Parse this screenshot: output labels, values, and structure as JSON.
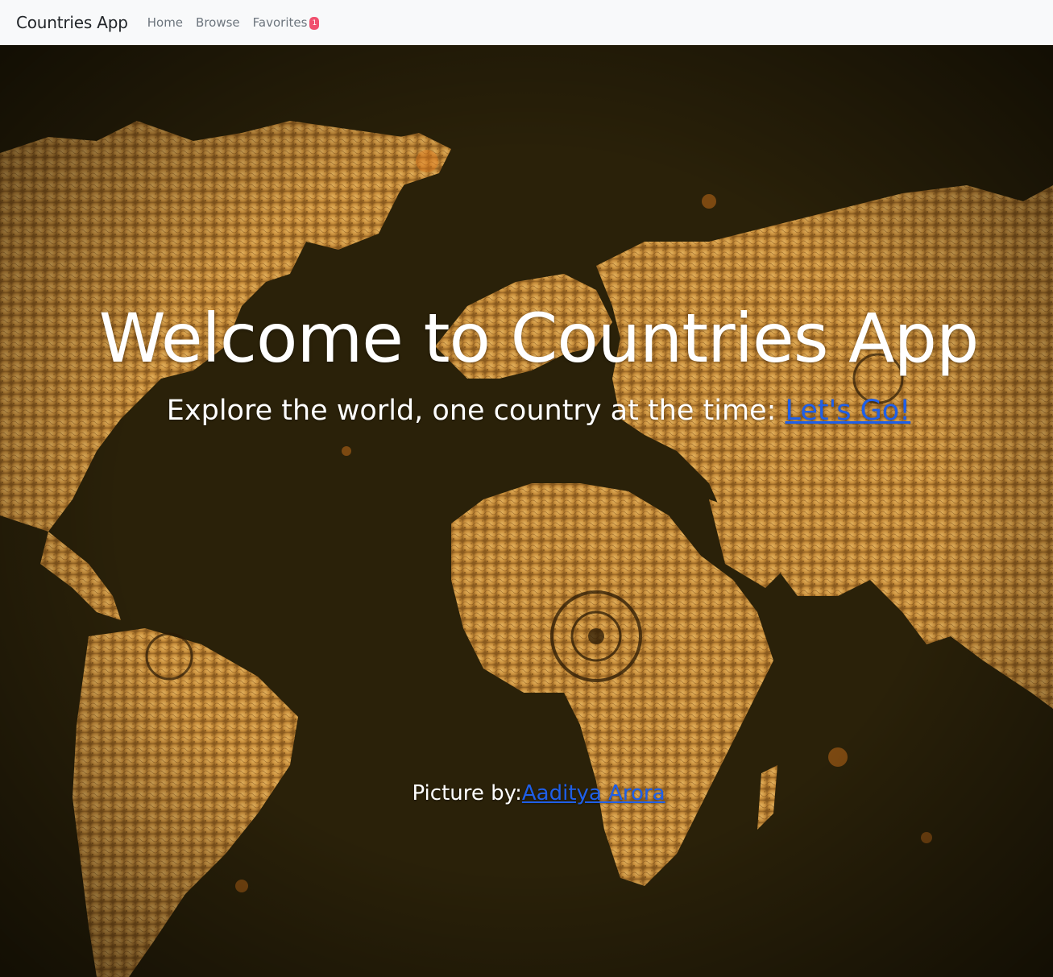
{
  "navbar": {
    "brand": "Countries App",
    "links": [
      {
        "label": "Home"
      },
      {
        "label": "Browse"
      },
      {
        "label": "Favorites",
        "badge": "1"
      }
    ]
  },
  "hero": {
    "title": "Welcome to Countries App",
    "subtitle_text": "Explore the world, one country at the time: ",
    "subtitle_link": "Let's Go!",
    "credit_text": "Picture by:",
    "credit_link": "Aaditya Arora",
    "background": "vintage world map photograph"
  },
  "colors": {
    "navbar_bg": "#f8f9fa",
    "link_blue": "#1f5fe8",
    "badge_red": "#f0506e",
    "map_land": "#d9a24a",
    "map_dark": "#1e1806"
  }
}
